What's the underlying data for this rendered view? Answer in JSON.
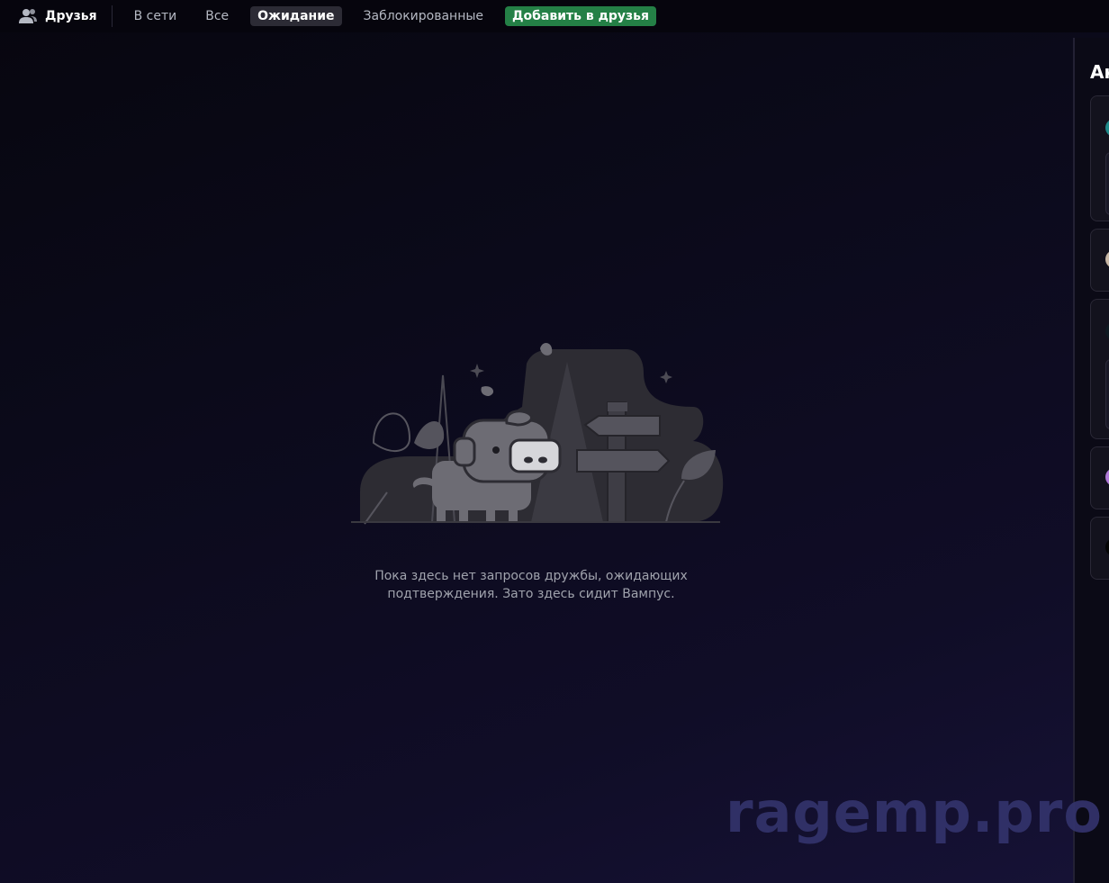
{
  "header": {
    "title": "Друзья",
    "icon": "friends-icon",
    "tabs": [
      {
        "label": "В сети",
        "active": false
      },
      {
        "label": "Все",
        "active": false
      },
      {
        "label": "Ожидание",
        "active": true
      },
      {
        "label": "Заблокированные",
        "active": false
      }
    ],
    "add_friend_label": "Добавить в друзья",
    "add_friend_color": "#248046"
  },
  "main": {
    "empty_text_line1": "Пока здесь нет запросов дружбы, ожидающих",
    "empty_text_line2": "подтверждения. Зато здесь сидит Вампус."
  },
  "right_panel": {
    "title": "Ак"
  },
  "watermark": "ragemp.pro",
  "colors": {
    "accent_green": "#248046",
    "background": "#0c0a1c"
  }
}
